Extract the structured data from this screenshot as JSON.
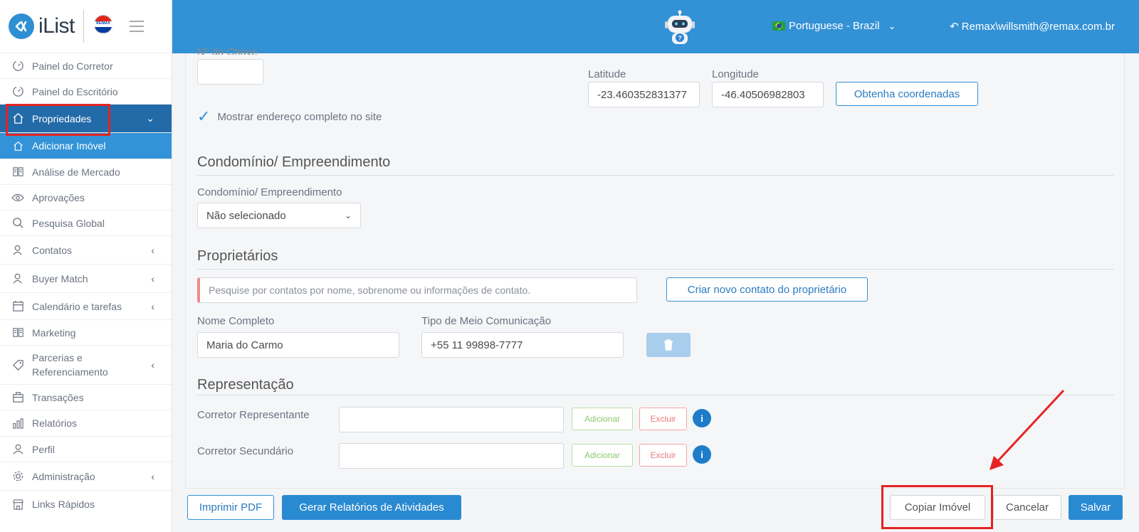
{
  "brand": {
    "logo_text": "iList",
    "remax_tag": "RE/MAX"
  },
  "header": {
    "language": "Portuguese - Brazil",
    "user": "Remax\\willsmith@remax.com.br"
  },
  "sidebar": {
    "items": [
      {
        "label": "Painel do Corretor",
        "icon": "speedometer-icon"
      },
      {
        "label": "Painel do Escritório",
        "icon": "speedometer-icon"
      },
      {
        "label": "Propriedades",
        "icon": "home-icon"
      },
      {
        "label": "Adicionar Imóvel",
        "icon": "home-icon"
      },
      {
        "label": "Análise de Mercado",
        "icon": "book-icon"
      },
      {
        "label": "Aprovações",
        "icon": "eye-icon"
      },
      {
        "label": "Pesquisa Global",
        "icon": "search-icon"
      },
      {
        "label": "Contatos",
        "icon": "users-icon"
      },
      {
        "label": "Buyer Match",
        "icon": "users-icon"
      },
      {
        "label": "Calendário e tarefas",
        "icon": "calendar-icon"
      },
      {
        "label": "Marketing",
        "icon": "book-icon"
      },
      {
        "label": "Parcerias e Referenciamento",
        "icon": "tag-icon"
      },
      {
        "label": "Transações",
        "icon": "briefcase-icon"
      },
      {
        "label": "Relatórios",
        "icon": "bar-chart-icon"
      },
      {
        "label": "Perfil",
        "icon": "user-icon"
      },
      {
        "label": "Administração",
        "icon": "gear-icon"
      },
      {
        "label": "Links Rápidos",
        "icon": "store-icon"
      }
    ]
  },
  "form": {
    "key_label_partial": "Nº da Chave",
    "latitude_label": "Latitude",
    "latitude_value": "-23.460352831377",
    "longitude_label": "Longitude",
    "longitude_value": "-46.40506982803",
    "get_coords_button": "Obtenha coordenadas",
    "show_address_check": "Mostrar endereço completo no site",
    "condo_section": "Condomínio/ Empreendimento",
    "condo_label": "Condomínio/ Empreendimento",
    "condo_value": "Não selecionado",
    "owners_section": "Proprietários",
    "owner_search_placeholder": "Pesquise por contatos por nome, sobrenome ou informações de contato.",
    "create_owner_button": "Criar novo contato do proprietário",
    "full_name_label": "Nome Completo",
    "full_name_value": "Maria do Carmo",
    "comm_type_label": "Tipo de Meio Comunicação",
    "comm_type_value": "+55 11 99898-7777",
    "representation_section": "Representação",
    "rep_agent_label": "Corretor Representante",
    "sec_agent_label": "Corretor Secundário",
    "add_label": "Adicionar",
    "remove_label": "Excluir",
    "info_glyph": "i"
  },
  "footer": {
    "print_pdf": "Imprimir PDF",
    "activity_reports": "Gerar Relatórios de Atividades",
    "copy_property": "Copiar Imóvel",
    "cancel": "Cancelar",
    "save": "Salvar"
  },
  "colors": {
    "header_blue": "#3391d5",
    "sidebar_active": "#236aa8",
    "sidebar_sub_active": "#3393d8",
    "annotation_red": "#e52323"
  }
}
